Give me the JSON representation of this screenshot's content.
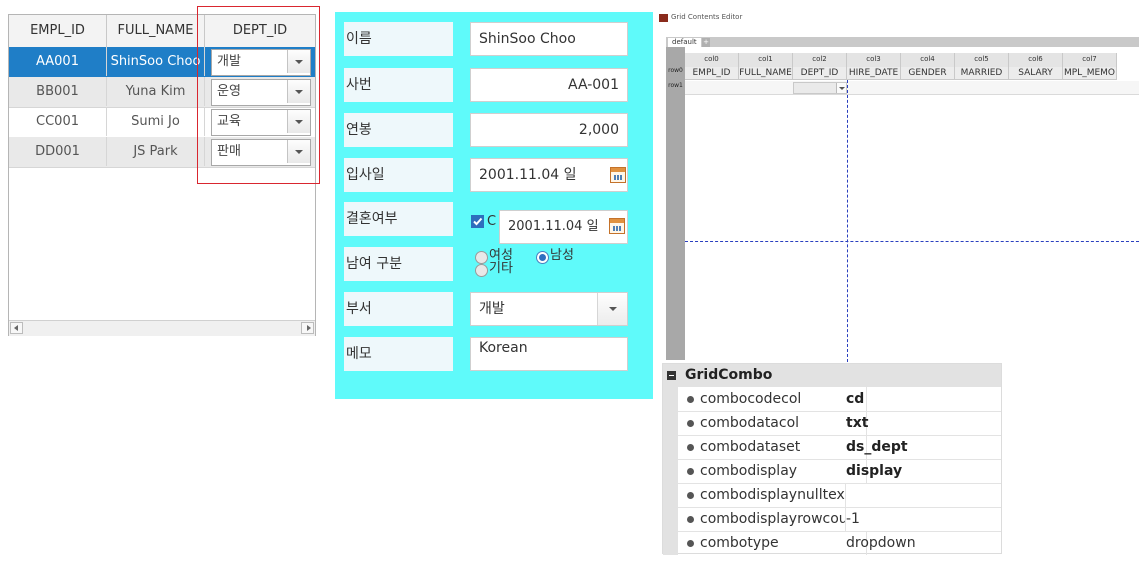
{
  "grid": {
    "columns": [
      "EMPL_ID",
      "FULL_NAME",
      "DEPT_ID"
    ],
    "rows": [
      {
        "empl_id": "AA001",
        "full_name": "ShinSoo Choo",
        "dept": "개발"
      },
      {
        "empl_id": "BB001",
        "full_name": "Yuna Kim",
        "dept": "운영"
      },
      {
        "empl_id": "CC001",
        "full_name": "Sumi Jo",
        "dept": "교육"
      },
      {
        "empl_id": "DD001",
        "full_name": "JS Park",
        "dept": "판매"
      }
    ]
  },
  "form": {
    "name_label": "이름",
    "name_value": "ShinSoo Choo",
    "empno_label": "사번",
    "empno_value": "AA-001",
    "salary_label": "연봉",
    "salary_value": "2,000",
    "hire_label": "입사일",
    "hire_value": "2001.11.04 일",
    "married_label": "결혼여부",
    "married_overlay_value": "2001.11.04 일",
    "married_checkbox_partial": "C",
    "gender_label": "남여 구분",
    "gender_female": "여성",
    "gender_male": "남성",
    "gender_other": "기타",
    "dept_label": "부서",
    "dept_value": "개발",
    "memo_label": "메모",
    "memo_value": "Korean"
  },
  "editor": {
    "title": "Grid Contents Editor",
    "tab": "default",
    "tab_add": "+",
    "col_headers": [
      "col0",
      "col1",
      "col2",
      "col3",
      "col4",
      "col5",
      "col6",
      "col7"
    ],
    "row_headers": [
      "row0",
      "row1"
    ],
    "row0_cells": [
      "EMPL_ID",
      "FULL_NAME",
      "DEPT_ID",
      "HIRE_DATE",
      "GENDER",
      "MARRIED",
      "SALARY",
      "MPL_MEMO"
    ]
  },
  "properties": {
    "group": "GridCombo",
    "items": [
      {
        "name": "combocodecol",
        "value": "cd",
        "bold": true
      },
      {
        "name": "combodatacol",
        "value": "txt",
        "bold": true
      },
      {
        "name": "combodataset",
        "value": "ds_dept",
        "bold": true
      },
      {
        "name": "combodisplay",
        "value": "display",
        "bold": true
      },
      {
        "name": "combodisplaynulltext",
        "value": "",
        "bold": false
      },
      {
        "name": "combodisplayrowcount",
        "value": "-1",
        "bold": false
      },
      {
        "name": "combotype",
        "value": "dropdown",
        "bold": false
      }
    ]
  },
  "colors": {
    "form_bg": "#5ffafa",
    "selected_row": "#1f7ec7",
    "highlight_box": "#d9262f",
    "guide_line": "#2a3fbf"
  }
}
